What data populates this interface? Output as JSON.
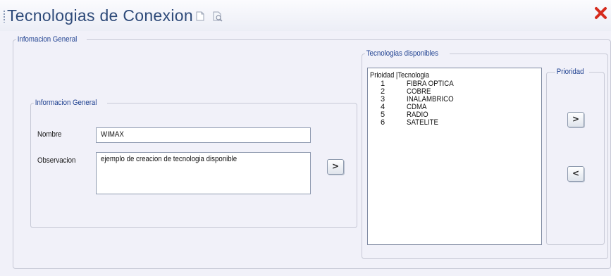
{
  "window": {
    "title": "Tecnologias de Conexion",
    "close_icon": "close-x-icon"
  },
  "general": {
    "legend": "Infomacion General"
  },
  "form": {
    "legend": "Informacion General",
    "nombre_label": "Nombre",
    "nombre_value": "WIMAX",
    "observacion_label": "Observacion",
    "observacion_value": "ejemplo de creacion de tecnologia disponible",
    "add_button": ">"
  },
  "tech": {
    "legend": "Tecnologias disponibles",
    "header": "Prioidad |Tecnologia",
    "items": [
      {
        "priority": "1",
        "name": "FIBRA OPTICA"
      },
      {
        "priority": "2",
        "name": "COBRE"
      },
      {
        "priority": "3",
        "name": "INALAMBRICO"
      },
      {
        "priority": "4",
        "name": "CDMA"
      },
      {
        "priority": "5",
        "name": "RADIO"
      },
      {
        "priority": "6",
        "name": "SATELITE"
      }
    ]
  },
  "priority": {
    "legend": "Prioridad",
    "up_button": ">",
    "down_button": "<"
  },
  "colors": {
    "title": "#2e4a79",
    "legend": "#1d3f8f",
    "close": "#d62b1d",
    "background": "#f1f1f9"
  }
}
